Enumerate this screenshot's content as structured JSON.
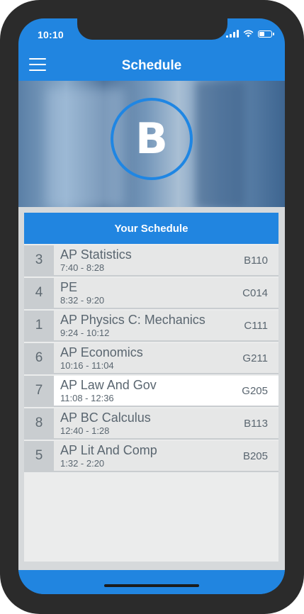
{
  "status_bar": {
    "time": "10:10"
  },
  "header": {
    "title": "Schedule",
    "menu_icon": "hamburger-menu-icon"
  },
  "day": {
    "letter": "B"
  },
  "schedule": {
    "heading": "Your Schedule",
    "rows": [
      {
        "period": "3",
        "course": "AP Statistics",
        "time": "7:40 - 8:28",
        "room": "B110"
      },
      {
        "period": "4",
        "course": "PE",
        "time": "8:32 - 9:20",
        "room": "C014"
      },
      {
        "period": "1",
        "course": "AP Physics C: Mechanics",
        "time": "9:24 - 10:12",
        "room": "C111"
      },
      {
        "period": "6",
        "course": "AP Economics",
        "time": "10:16 - 11:04",
        "room": "G211"
      },
      {
        "period": "7",
        "course": "AP Law And Gov",
        "time": "11:08 - 12:36",
        "room": "G205"
      },
      {
        "period": "8",
        "course": "AP BC Calculus",
        "time": "12:40 - 1:28",
        "room": "B113"
      },
      {
        "period": "5",
        "course": "AP Lit And Comp",
        "time": "1:32 - 2:20",
        "room": "B205"
      }
    ]
  },
  "colors": {
    "accent": "#2185e0",
    "device": "#2b2b2b",
    "row_bg": "#e6e7e7",
    "row_active_bg": "#ffffff",
    "period_bg": "#c9cdd0",
    "text": "#5a6670"
  }
}
